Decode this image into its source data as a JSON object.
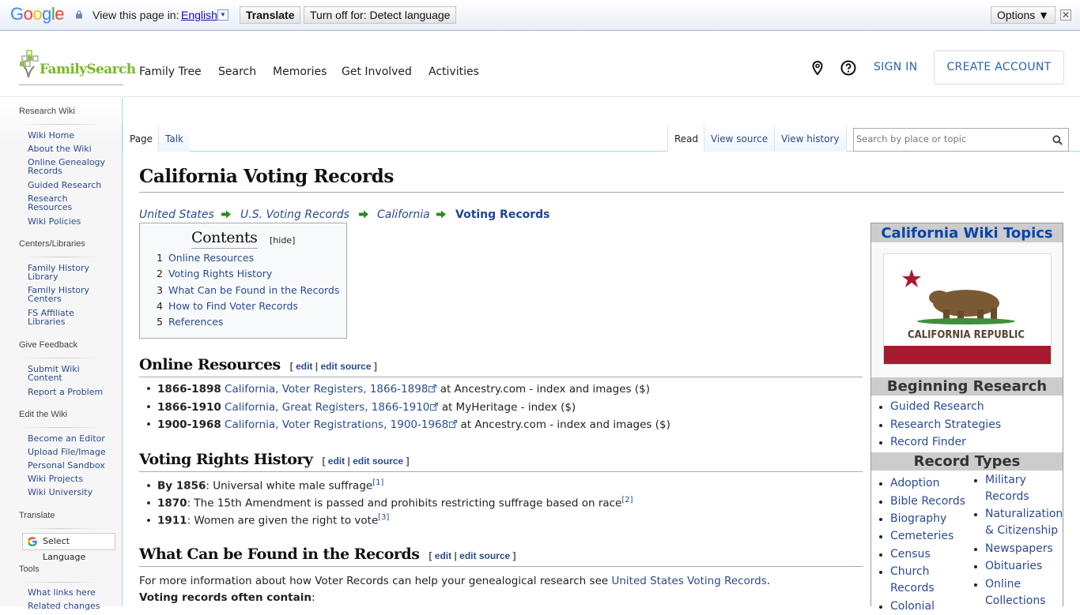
{
  "translate_bar": {
    "google_logo": "Google",
    "view_label": "View this page in:",
    "language": "English",
    "translate_button": "Translate",
    "turn_off_button": "Turn off for: Detect language",
    "options_button": "Options ▼",
    "close_icon": "✕"
  },
  "header": {
    "logo_text": "FamilySearch",
    "nav": [
      "Family Tree",
      "Search",
      "Memories",
      "Get Involved",
      "Activities"
    ],
    "sign_in": "SIGN IN",
    "create_account": "CREATE ACCOUNT"
  },
  "sidebar": {
    "sections": [
      {
        "heading": "Research Wiki",
        "items": [
          "Wiki Home",
          "About the Wiki",
          "Online Genealogy Records",
          "Guided Research",
          "Research Resources",
          "Wiki Policies"
        ]
      },
      {
        "heading": "Centers/Libraries",
        "items": [
          "Family History Library",
          "Family History Centers",
          "FS Affiliate Libraries"
        ]
      },
      {
        "heading": "Give Feedback",
        "items": [
          "Submit Wiki Content",
          "Report a Problem"
        ]
      },
      {
        "heading": "Edit the Wiki",
        "items": [
          "Become an Editor",
          "Upload File/Image",
          "Personal Sandbox",
          "Wiki Projects",
          "Wiki University"
        ]
      },
      {
        "heading": "Translate",
        "select_language": "Select Language"
      },
      {
        "heading": "Tools",
        "items": [
          "What links here",
          "Related changes"
        ]
      }
    ]
  },
  "tabs": {
    "left": [
      "Page",
      "Talk"
    ],
    "right": [
      "Read",
      "View source",
      "View history"
    ],
    "search_placeholder": "Search by place or topic"
  },
  "page": {
    "title": "California Voting Records",
    "breadcrumb": [
      "United States",
      "U.S. Voting Records",
      "California",
      "Voting Records"
    ],
    "toc": {
      "title": "Contents",
      "hide": "[hide]",
      "items": [
        {
          "n": "1",
          "label": "Online Resources"
        },
        {
          "n": "2",
          "label": "Voting Rights History"
        },
        {
          "n": "3",
          "label": "What Can be Found in the Records"
        },
        {
          "n": "4",
          "label": "How to Find Voter Records"
        },
        {
          "n": "5",
          "label": "References"
        }
      ]
    },
    "edit_links": {
      "open": "[",
      "edit": "edit",
      "sep": "|",
      "edit_source": "edit source",
      "close": "]"
    },
    "sections": {
      "online": {
        "heading": "Online Resources",
        "items": [
          {
            "years": "1866-1898",
            "link": "California, Voter Registers, 1866-1898",
            "rest": " at Ancestry.com - index and images ($)"
          },
          {
            "years": "1866-1910",
            "link": "California, Great Registers, 1866-1910",
            "rest": " at MyHeritage - index ($)"
          },
          {
            "years": "1900-1968",
            "link": "California, Voter Registrations, 1900-1968",
            "rest": " at Ancestry.com - index and images ($)"
          }
        ]
      },
      "history": {
        "heading": "Voting Rights History",
        "items": [
          {
            "bold": "By 1856",
            "text": ": Universal white male suffrage",
            "ref": "[1]"
          },
          {
            "bold": "1870",
            "text": ": The 15th Amendment is passed and prohibits restricting suffrage based on race",
            "ref": "[2]"
          },
          {
            "bold": "1911",
            "text": ": Women are given the right to vote",
            "ref": "[3]"
          }
        ]
      },
      "found": {
        "heading": "What Can be Found in the Records",
        "para_text": "For more information about how Voter Records can help your genealogical research see ",
        "para_link": "United States Voting Records",
        "para_end": ".",
        "contain_bold": "Voting records often contain",
        "contain_end": ":"
      }
    }
  },
  "infobox": {
    "title": "California Wiki Topics",
    "flag_text": "CALIFORNIA REPUBLIC",
    "beginning_heading": "Beginning Research",
    "beginning": [
      "Guided Research",
      "Research Strategies",
      "Record Finder"
    ],
    "record_types_heading": "Record Types",
    "col1": [
      "Adoption",
      "Bible Records",
      "Biography",
      "Cemeteries",
      "Census",
      "Church Records",
      "Colonial"
    ],
    "col2": [
      "Military Records",
      "Naturalization & Citizenship",
      "Newspapers",
      "Obituaries",
      "Online Collections"
    ]
  }
}
